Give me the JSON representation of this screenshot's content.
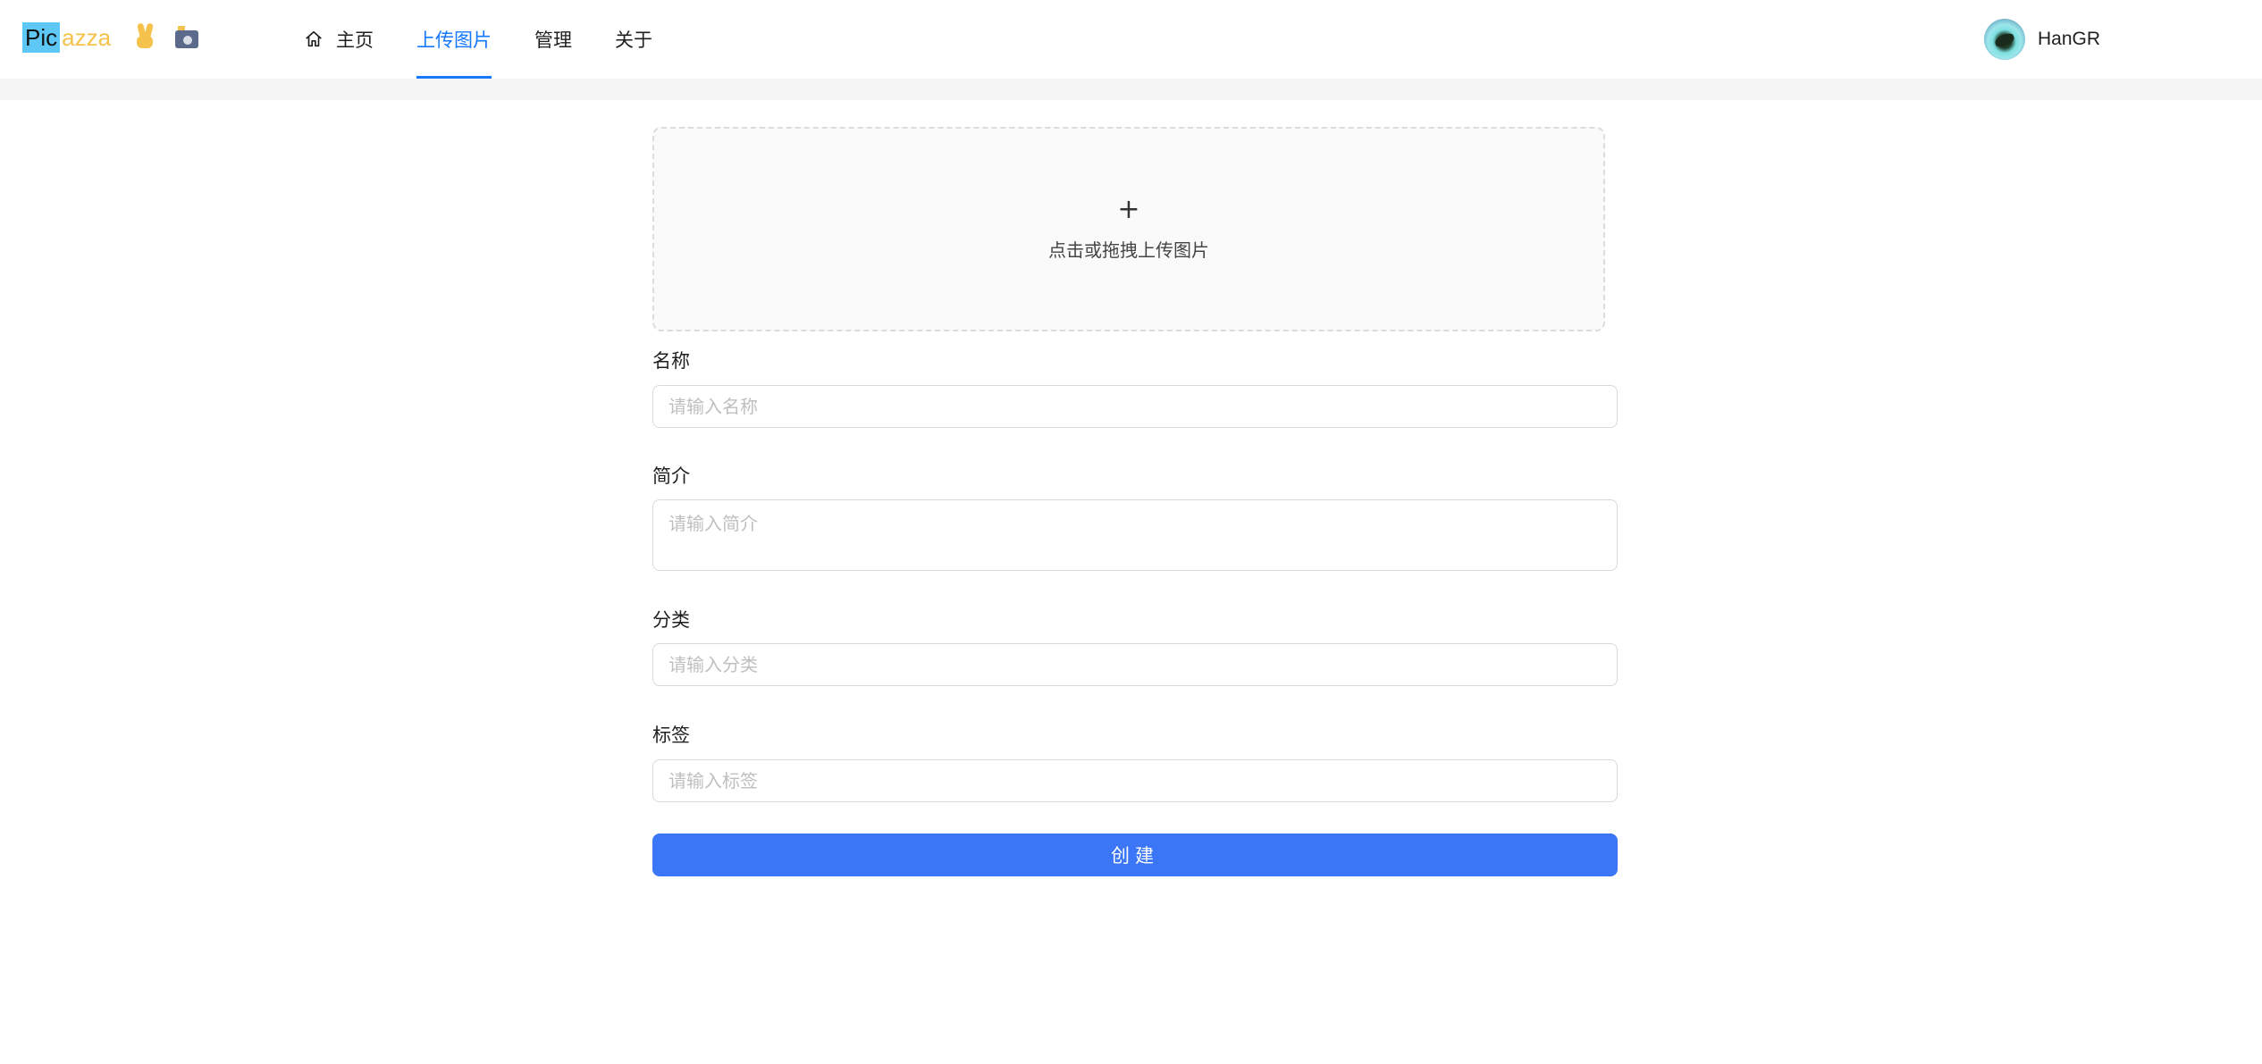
{
  "header": {
    "logo": {
      "part1": "Pic",
      "part2": "azza"
    },
    "icons": [
      "peace-hand-icon",
      "camera-icon"
    ],
    "nav": [
      {
        "label": "主页",
        "icon": "home-icon",
        "active": false
      },
      {
        "label": "上传图片",
        "active": true
      },
      {
        "label": "管理",
        "active": false
      },
      {
        "label": "关于",
        "active": false
      }
    ],
    "user": {
      "name": "HanGR"
    }
  },
  "upload": {
    "icon": "plus-icon",
    "text": "点击或拖拽上传图片"
  },
  "form": {
    "name": {
      "label": "名称",
      "placeholder": "请输入名称"
    },
    "intro": {
      "label": "简介",
      "placeholder": "请输入简介"
    },
    "category": {
      "label": "分类",
      "placeholder": "请输入分类"
    },
    "tags": {
      "label": "标签",
      "placeholder": "请输入标签"
    },
    "submit_label": "创建"
  },
  "colors": {
    "accent": "#1677ff",
    "button": "#3a76f5",
    "logo_bg": "#5dc7f5",
    "logo_text": "#f5c24c"
  }
}
